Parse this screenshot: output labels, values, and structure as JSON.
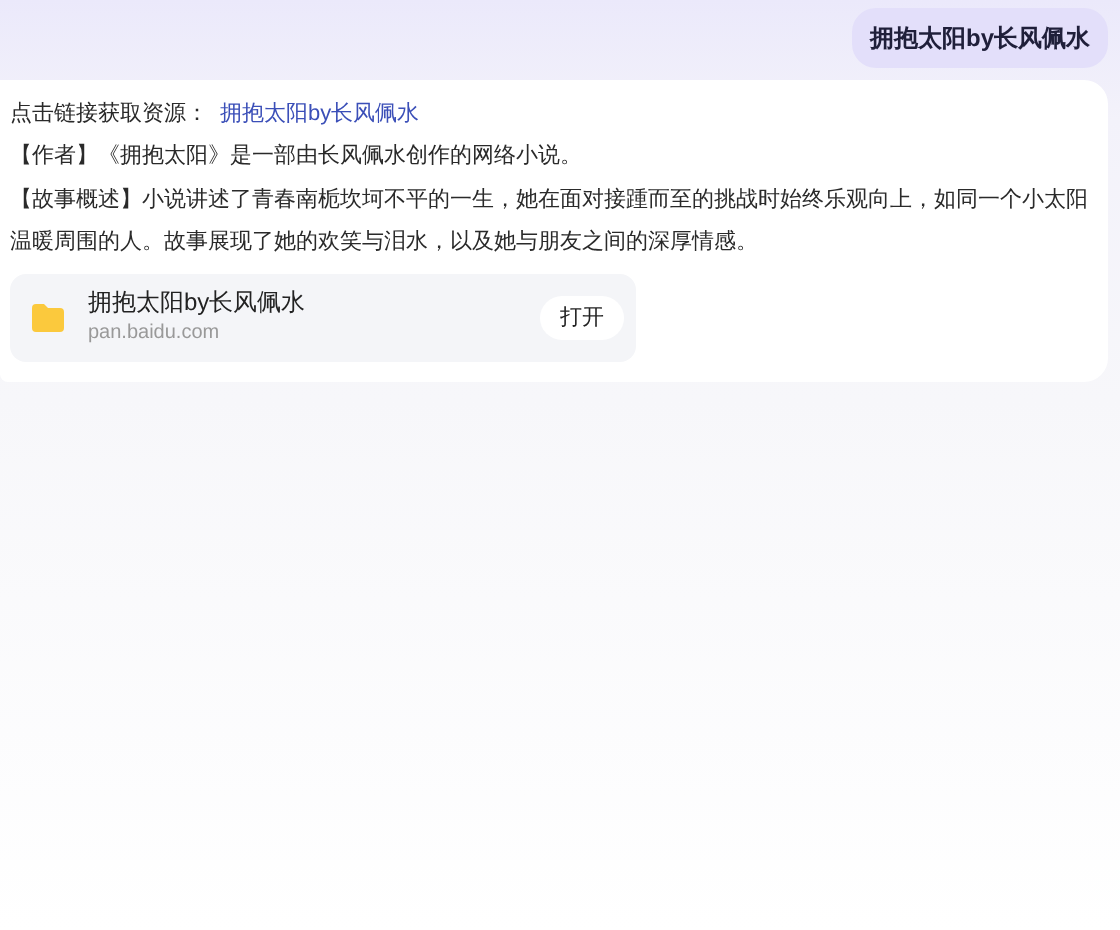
{
  "user_message": "拥抱太阳by长风佩水",
  "answer": {
    "link_prefix": "点击链接获取资源：",
    "link_text": "拥抱太阳by长风佩水",
    "paragraphs": [
      "【作者】《拥抱太阳》是一部由长风佩水创作的网络小说。",
      "【故事概述】小说讲述了青春南栀坎坷不平的一生，她在面对接踵而至的挑战时始终乐观向上，如同一个小太阳温暖周围的人。故事展现了她的欢笑与泪水，以及她与朋友之间的深厚情感。"
    ],
    "resource_card": {
      "title": "拥抱太阳by长风佩水",
      "domain": "pan.baidu.com",
      "button": "打开"
    }
  }
}
